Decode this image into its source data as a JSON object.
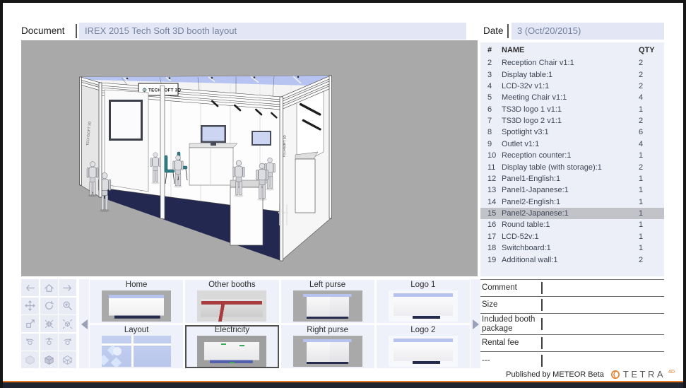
{
  "header": {
    "document_label": "Document",
    "document_title": "IREX 2015 Tech Soft 3D booth layout",
    "date_label": "Date",
    "date_value": "3 (Oct/20/2015)"
  },
  "viewport": {
    "booth_banner": "TECHSOFT 3D",
    "side_banner": "TECHSOFT 3D"
  },
  "parts_table": {
    "columns": {
      "num": "#",
      "name": "NAME",
      "qty": "QTY"
    },
    "selected_num": 15,
    "rows": [
      {
        "num": 2,
        "name": "Reception Chair v1:1",
        "qty": 2
      },
      {
        "num": 3,
        "name": "Display table:1",
        "qty": 2
      },
      {
        "num": 4,
        "name": "LCD-32v v1:1",
        "qty": 2
      },
      {
        "num": 5,
        "name": "Meeting Chair v1:1",
        "qty": 4
      },
      {
        "num": 6,
        "name": "TS3D logo 1 v1:1",
        "qty": 1
      },
      {
        "num": 7,
        "name": "TS3D logo 2 v1:1",
        "qty": 2
      },
      {
        "num": 8,
        "name": "Spotlight v3:1",
        "qty": 6
      },
      {
        "num": 9,
        "name": "Outlet v1:1",
        "qty": 4
      },
      {
        "num": 10,
        "name": "Reception counter:1",
        "qty": 1
      },
      {
        "num": 11,
        "name": "Display table (with storage):1",
        "qty": 2
      },
      {
        "num": 12,
        "name": "Panel1-English:1",
        "qty": 1
      },
      {
        "num": 13,
        "name": "Panel1-Japanese:1",
        "qty": 1
      },
      {
        "num": 14,
        "name": "Panel2-English:1",
        "qty": 1
      },
      {
        "num": 15,
        "name": "Panel2-Japanese:1",
        "qty": 1
      },
      {
        "num": 16,
        "name": "Round table:1",
        "qty": 1
      },
      {
        "num": 17,
        "name": "LCD-52v:1",
        "qty": 1
      },
      {
        "num": 18,
        "name": "Switchboard:1",
        "qty": 1
      },
      {
        "num": 19,
        "name": "Additional wall:1",
        "qty": 2
      }
    ]
  },
  "toolbar": {
    "buttons": [
      {
        "icon": "back-arrow-icon"
      },
      {
        "icon": "home-icon"
      },
      {
        "icon": "forward-arrow-icon"
      },
      {
        "icon": "pan-icon"
      },
      {
        "icon": "orbit-rotate-icon"
      },
      {
        "icon": "zoom-icon"
      },
      {
        "icon": "resize-icon"
      },
      {
        "icon": "zoom-fit-icon"
      },
      {
        "icon": "expand-cube-icon"
      },
      {
        "icon": "turntable-left-icon"
      },
      {
        "icon": "turntable-front-icon"
      },
      {
        "icon": "turntable-right-icon"
      },
      {
        "icon": "solid-cube-icon"
      },
      {
        "icon": "shaded-cube-icon"
      },
      {
        "icon": "wireframe-cube-icon"
      }
    ]
  },
  "thumbnails": {
    "items": [
      {
        "label": "Home",
        "art": "booth-gray",
        "selected": false
      },
      {
        "label": "Other booths",
        "art": "floorplan-red",
        "selected": false
      },
      {
        "label": "Left purse",
        "art": "booth-gray2",
        "selected": false
      },
      {
        "label": "Logo 1",
        "art": "booth-white",
        "selected": false
      },
      {
        "label": "Layout",
        "art": "plan-blue",
        "selected": false
      },
      {
        "label": "Electricity",
        "art": "room-gray",
        "selected": true
      },
      {
        "label": "Right purse",
        "art": "booth-gray2",
        "selected": false
      },
      {
        "label": "Logo 2",
        "art": "booth-white",
        "selected": false
      }
    ]
  },
  "details": {
    "fields": [
      {
        "label": "Comment",
        "value": ""
      },
      {
        "label": "Size",
        "value": ""
      },
      {
        "label": "Included booth package",
        "value": ""
      },
      {
        "label": "Rental fee",
        "value": ""
      },
      {
        "label": "---",
        "value": ""
      }
    ]
  },
  "footer": {
    "published": "Published by METEOR Beta",
    "brand": "TETRA",
    "brand_sup": "4D"
  },
  "colors": {
    "accent_orange": "#e87a24",
    "selection_gray": "#c2c3c8",
    "field_bg": "#e3e7f5",
    "viewport_bg": "#a9a9a9",
    "floor_navy": "#232850",
    "ceiling_blue": "#b7c4f2",
    "frame_navy": "#1e2530"
  }
}
